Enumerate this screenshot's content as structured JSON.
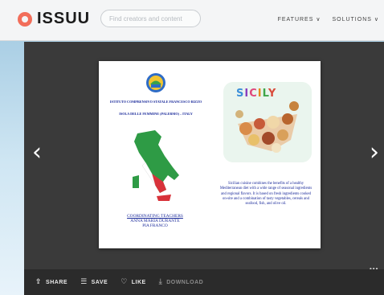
{
  "header": {
    "logo_text": "ISSUU",
    "search_placeholder": "Find creators and content",
    "nav": [
      "FEATURES ∨",
      "SOLUTIONS ∨"
    ]
  },
  "viewer": {
    "left_page": {
      "school_name": "ISTITUTO COMPRENSIVO STATALE FRANCESCO RIZZO",
      "school_place": "ISOLA DELLE FEMMINE (PALERMO) – ITALY",
      "coordinating_label": "COORDINATING TEACHERS",
      "teacher_1": "ANNA MARIA DURANTE",
      "teacher_2": "PIA FRANCO"
    },
    "right_page": {
      "title_letters": [
        "S",
        "I",
        "C",
        "I",
        "L",
        "Y"
      ],
      "description": "Sicilian cuisine combines the benefits of a healthy Mediterranean diet with a wide range of seasonal ingredients and regional flavors. It is based on fresh ingredients cooked on-site and a combination of tasty vegetables, cereals and seafood, fish, and olive oil."
    },
    "more_label": "•••"
  },
  "toolbar": {
    "share": "SHARE",
    "save": "SAVE",
    "like": "LIKE",
    "download": "DOWNLOAD"
  },
  "icons": {
    "logo": "issuu-logo-icon",
    "prev": "chevron-left-icon",
    "next": "chevron-right-icon",
    "share": "share-icon",
    "save": "bookmark-icon",
    "like": "heart-icon",
    "download": "download-icon"
  }
}
